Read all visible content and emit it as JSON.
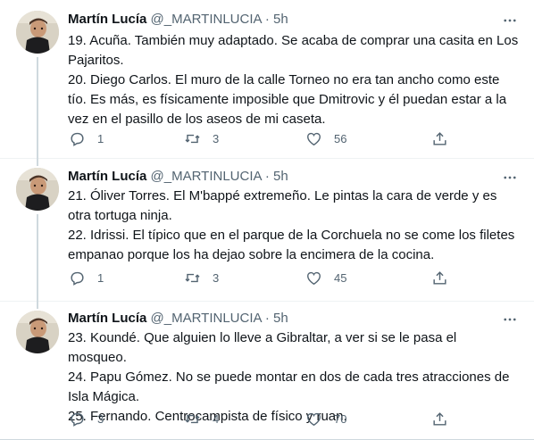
{
  "tweets": [
    {
      "name": "Martín Lucía",
      "handle": "@_MARTINLUCIA",
      "dot": "·",
      "time": "5h",
      "lines": [
        "19. Acuña. También muy adaptado. Se acaba de comprar una casita en Los Pajaritos.",
        "20. Diego Carlos. El muro de la calle Torneo no era tan ancho como este tío. Es más, es físicamente imposible que Dmitrovic y él puedan estar a la vez en el pasillo de los aseos de mi caseta."
      ],
      "replies": "1",
      "retweets": "3",
      "likes": "56"
    },
    {
      "name": "Martín Lucía",
      "handle": "@_MARTINLUCIA",
      "dot": "·",
      "time": "5h",
      "lines": [
        "21. Óliver Torres. El M'bappé extremeño. Le pintas la cara de verde y es otra tortuga ninja.",
        "22. Idrissi. El típico que en el parque de la Corchuela no se come los filetes empanao porque los ha dejao sobre la encimera de la cocina."
      ],
      "replies": "1",
      "retweets": "3",
      "likes": "45"
    },
    {
      "name": "Martín Lucía",
      "handle": "@_MARTINLUCIA",
      "dot": "·",
      "time": "5h",
      "lines": [
        "23. Koundé. Que alguien lo lleve a Gibraltar, a ver si se le pasa el mosqueo.",
        "24. Papu Gómez. No se puede montar en dos de cada tres atracciones de Isla Mágica.",
        "25. Fernando. Centrocampista de físico y ruan."
      ],
      "replies": "3",
      "retweets": "4",
      "likes": "70"
    }
  ],
  "icons": {
    "more": "more-icon",
    "reply": "reply-icon",
    "retweet": "retweet-icon",
    "like": "heart-icon",
    "share": "share-icon"
  },
  "colors": {
    "text": "#0f1419",
    "secondary": "#536471",
    "thread_line": "#cfd9de"
  }
}
